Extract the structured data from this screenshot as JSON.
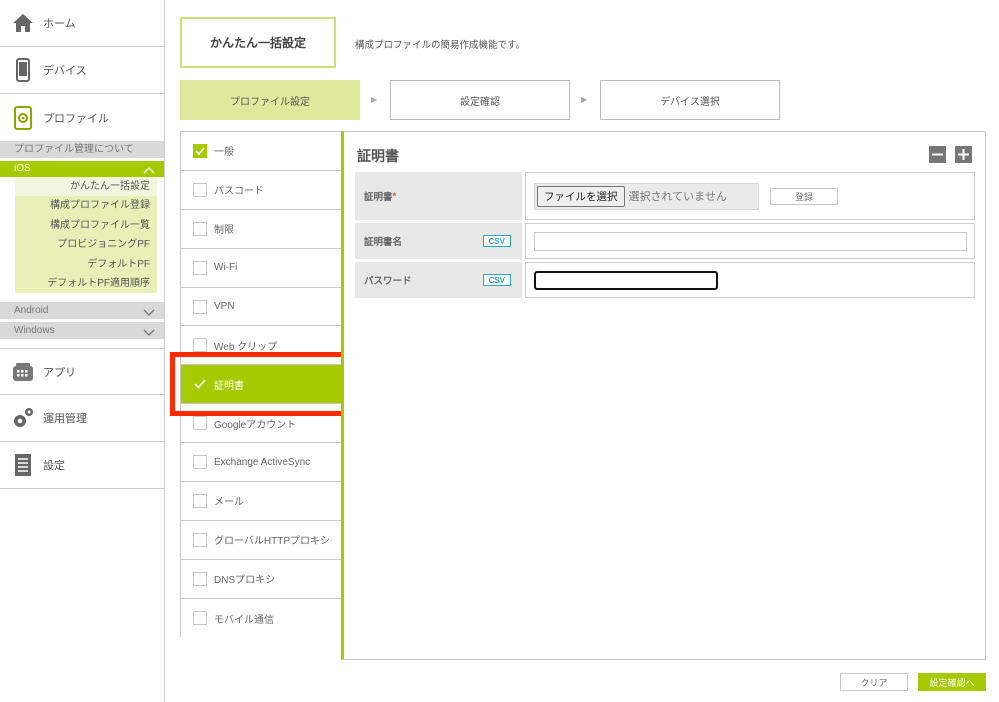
{
  "sidebar": {
    "home": "ホーム",
    "device": "デバイス",
    "profile": "プロファイル",
    "about_profile": "プロファイル管理について",
    "ios": "iOS",
    "ios_items": [
      "かんたん一括設定",
      "構成プロファイル登録",
      "構成プロファイル一覧",
      "プロビジョニングPF",
      "デフォルトPF",
      "デフォルトPF適用順序"
    ],
    "android": "Android",
    "windows": "Windows",
    "app": "アプリ",
    "operation": "運用管理",
    "settings": "設定"
  },
  "header": {
    "title": "かんたん一括設定",
    "description": "構成プロファイルの簡易作成機能です。"
  },
  "steps": [
    "プロファイル設定",
    "設定確認",
    "デバイス選択"
  ],
  "menu": {
    "items": [
      "一般",
      "パスコード",
      "制限",
      "Wi-Fi",
      "VPN",
      "Web クリップ",
      "証明書",
      "Googleアカウント",
      "Exchange ActiveSync",
      "メール",
      "グローバルHTTPプロキシ",
      "DNSプロキシ",
      "モバイル通信"
    ]
  },
  "panel": {
    "title": "証明書",
    "cert_label": "証明書",
    "required_mark": "*",
    "file_button": "ファイルを選択",
    "file_status": "選択されていません",
    "register_button": "登録",
    "cert_name_label": "証明書名",
    "password_label": "パスワード",
    "csv": "CSV"
  },
  "footer": {
    "clear": "クリア",
    "next": "設定確認へ"
  },
  "colors": {
    "accent": "#a7c900",
    "highlight": "#ff2a00"
  }
}
